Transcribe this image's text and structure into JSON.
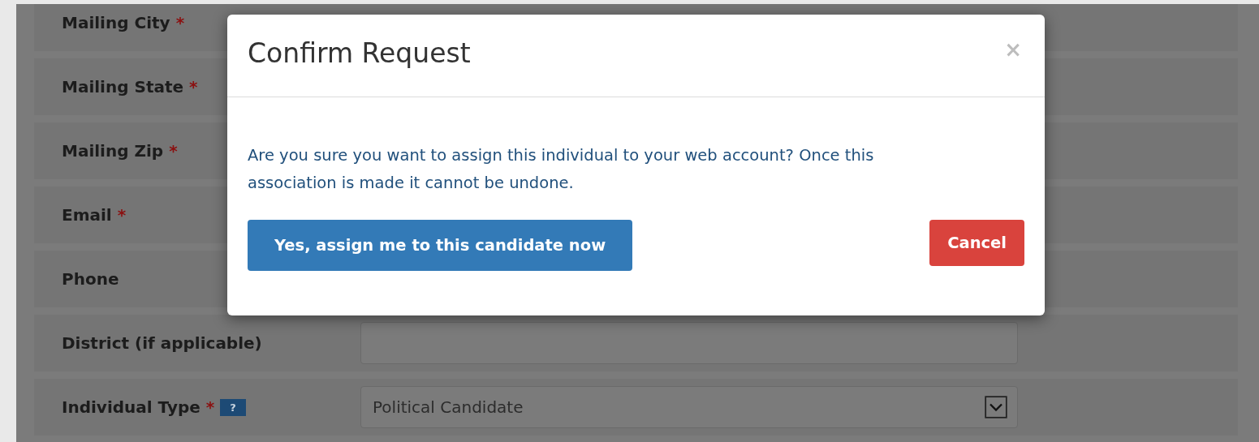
{
  "form": {
    "rows": [
      {
        "label": "Mailing City",
        "marker": "*",
        "kind": "plain"
      },
      {
        "label": "Mailing State",
        "marker": "*",
        "kind": "plain"
      },
      {
        "label": "Mailing Zip",
        "marker": "*",
        "kind": "plain"
      },
      {
        "label": "Email",
        "marker": "*",
        "kind": "plain"
      },
      {
        "label": "Phone",
        "kind": "plain"
      },
      {
        "label": "District (if applicable)",
        "kind": "input"
      },
      {
        "label": "Individual Type",
        "marker": "*",
        "help": "?",
        "kind": "select",
        "value": "Political Candidate"
      }
    ]
  },
  "dialog": {
    "title": "Confirm Request",
    "close": "×",
    "message": "Are you sure you want to assign this individual to your web account? Once this association is made it cannot be undone.",
    "confirm_button": "Yes, assign me to this candidate now",
    "cancel_button": "Cancel"
  }
}
